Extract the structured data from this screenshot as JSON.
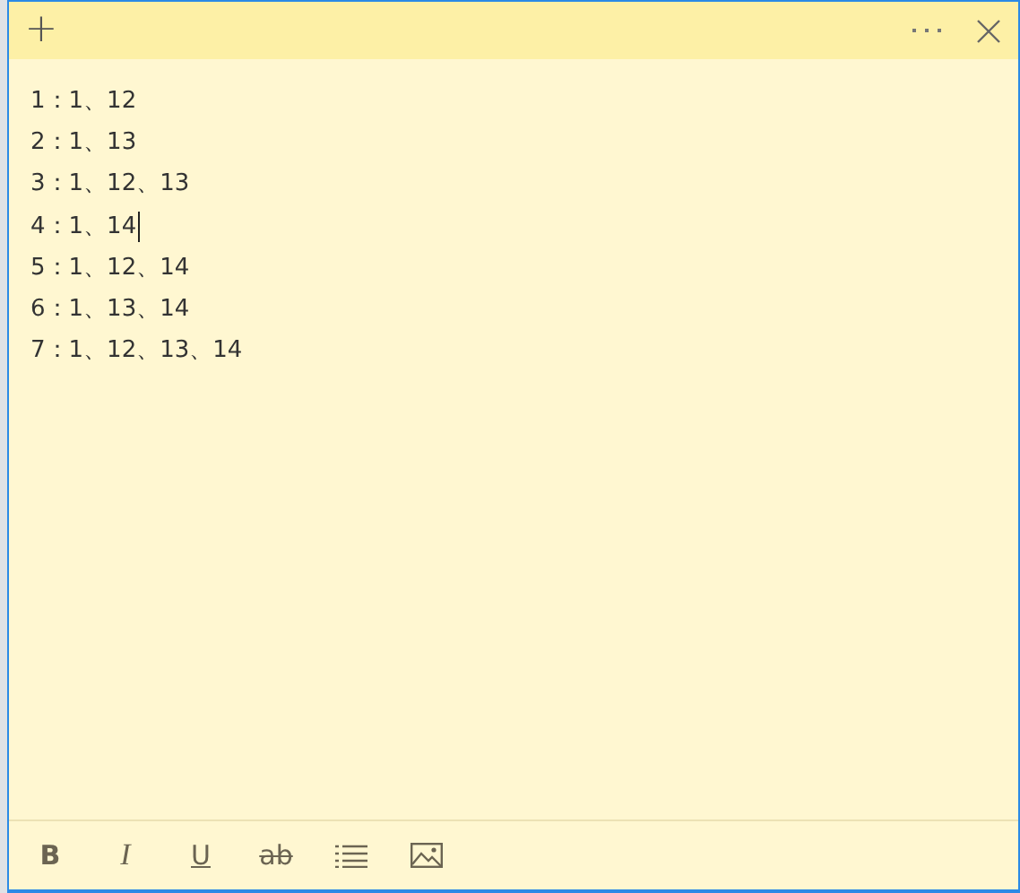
{
  "title_bar": {
    "new_note": "+"
  },
  "lines": [
    {
      "text": "1：1、12",
      "caret": false
    },
    {
      "text": "2：1、13",
      "caret": false
    },
    {
      "text": "3：1、12、13",
      "caret": false
    },
    {
      "text": "4：1、14",
      "caret": true
    },
    {
      "text": "5：1、12、14",
      "caret": false
    },
    {
      "text": "6：1、13、14",
      "caret": false
    },
    {
      "text": "7：1、12、13、14",
      "caret": false
    }
  ],
  "toolbar": [
    {
      "kind": "bold",
      "label": "B"
    },
    {
      "kind": "italic",
      "label": "I"
    },
    {
      "kind": "underline",
      "label": "U"
    },
    {
      "kind": "strike",
      "label": "ab"
    },
    {
      "kind": "list"
    },
    {
      "kind": "image"
    }
  ]
}
